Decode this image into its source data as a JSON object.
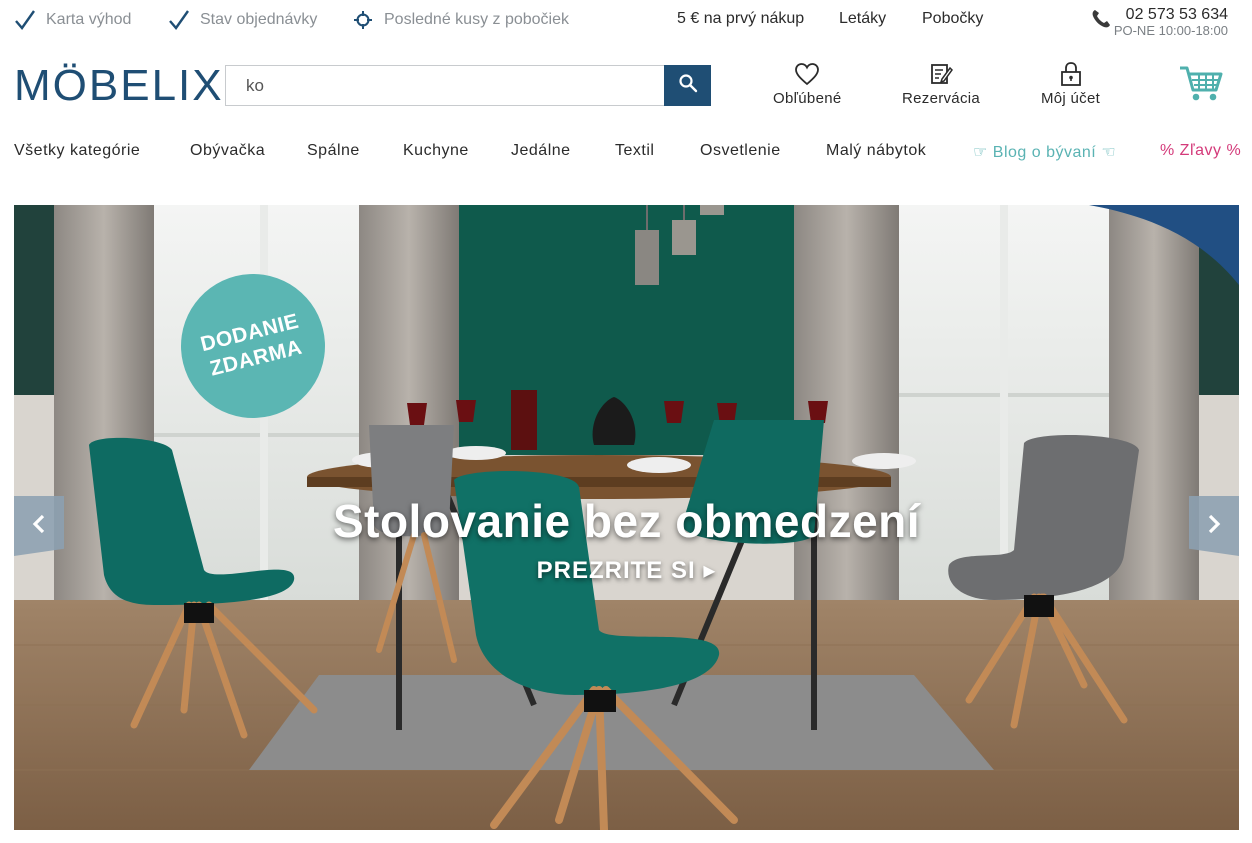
{
  "topbar": {
    "util": [
      {
        "label": "Karta výhod",
        "icon": "checkmark-icon"
      },
      {
        "label": "Stav objednávky",
        "icon": "checkmark-icon"
      },
      {
        "label": "Posledné kusy z pobočiek",
        "icon": "location-target-icon"
      }
    ],
    "links": [
      "5 € na prvý nákup",
      "Letáky",
      "Pobočky"
    ],
    "phone": {
      "number": "02 573 53 634",
      "hours": "PO-NE 10:00-18:00",
      "icon": "phone-icon"
    }
  },
  "header": {
    "logo": "MÖBELIX",
    "search": {
      "value": "ko",
      "icon": "search-icon"
    },
    "items": [
      {
        "label": "Obľúbené",
        "icon": "heart-icon"
      },
      {
        "label": "Rezervácia",
        "icon": "reservation-icon"
      },
      {
        "label": "Môj účet",
        "icon": "lock-icon"
      }
    ],
    "cart_icon": "cart-icon"
  },
  "nav": {
    "items": [
      "Všetky kategórie",
      "Obývačka",
      "Spálne",
      "Kuchyne",
      "Jedálne",
      "Textil",
      "Osvetlenie",
      "Malý nábytok"
    ],
    "blog": "☞ Blog o bývaní ☜",
    "sale": "% Zľavy %"
  },
  "hero": {
    "badge_line1": "DODANIE",
    "badge_line2": "ZDARMA",
    "headline": "Stolovanie bez obmedzení",
    "cta": "PREZRITE SI ▸"
  },
  "colors": {
    "brand": "#1f4e74",
    "teal": "#5bb6b3",
    "sale": "#d43a7a",
    "blog": "#5ab3b3"
  }
}
